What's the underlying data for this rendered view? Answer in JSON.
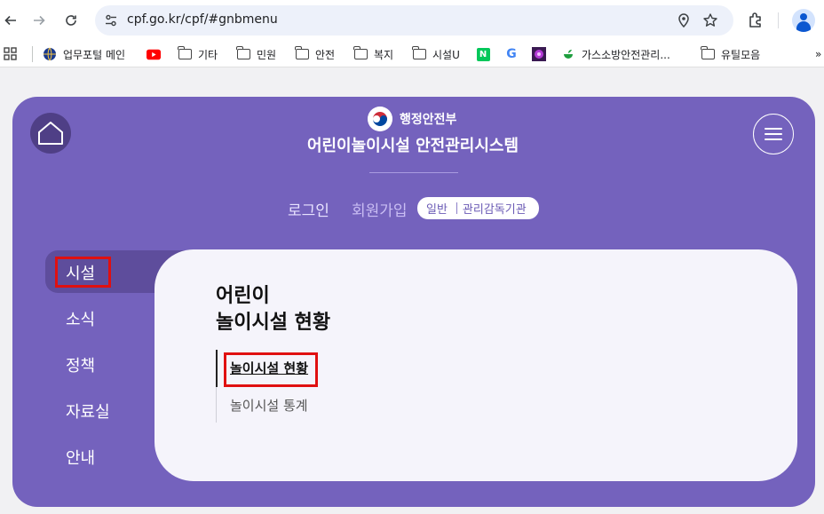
{
  "browser": {
    "url": "cpf.go.kr/cpf/#gnbmenu",
    "bookmarks": [
      {
        "label": "업무포털 메인",
        "icon": "globe-icon"
      },
      {
        "label": "",
        "icon": "youtube-icon"
      },
      {
        "label": "기타",
        "icon": "folder-icon"
      },
      {
        "label": "민원",
        "icon": "folder-icon"
      },
      {
        "label": "안전",
        "icon": "folder-icon"
      },
      {
        "label": "복지",
        "icon": "folder-icon"
      },
      {
        "label": "시설U",
        "icon": "folder-icon"
      },
      {
        "label": "N",
        "icon": "naver-icon"
      },
      {
        "label": "G",
        "icon": "google-icon"
      },
      {
        "label": "",
        "icon": "flower-icon"
      },
      {
        "label": "가스소방안전관리...",
        "icon": "green-icon"
      },
      {
        "label": "유틸모음",
        "icon": "folder-icon"
      },
      {
        "label": "»",
        "icon": "more-icon"
      }
    ]
  },
  "header": {
    "ministry": "행정안전부",
    "site_title": "어린이놀이시설 안전관리시스템"
  },
  "auth": {
    "login": "로그인",
    "signup": "회원가입",
    "pill_general": "일반",
    "pill_agency": "관리감독기관"
  },
  "sidebar": {
    "items": [
      {
        "label": "시설",
        "active": true
      },
      {
        "label": "소식"
      },
      {
        "label": "정책"
      },
      {
        "label": "자료실"
      },
      {
        "label": "안내"
      }
    ]
  },
  "panel": {
    "title_line1": "어린이",
    "title_line2": "놀이시설 현황",
    "submenu": [
      {
        "label": "놀이시설 현황",
        "active": true
      },
      {
        "label": "놀이시설 통계"
      }
    ]
  },
  "colors": {
    "panel_bg": "#7462bd",
    "highlight": "#e01010",
    "card_bg": "#f5f4fb"
  }
}
